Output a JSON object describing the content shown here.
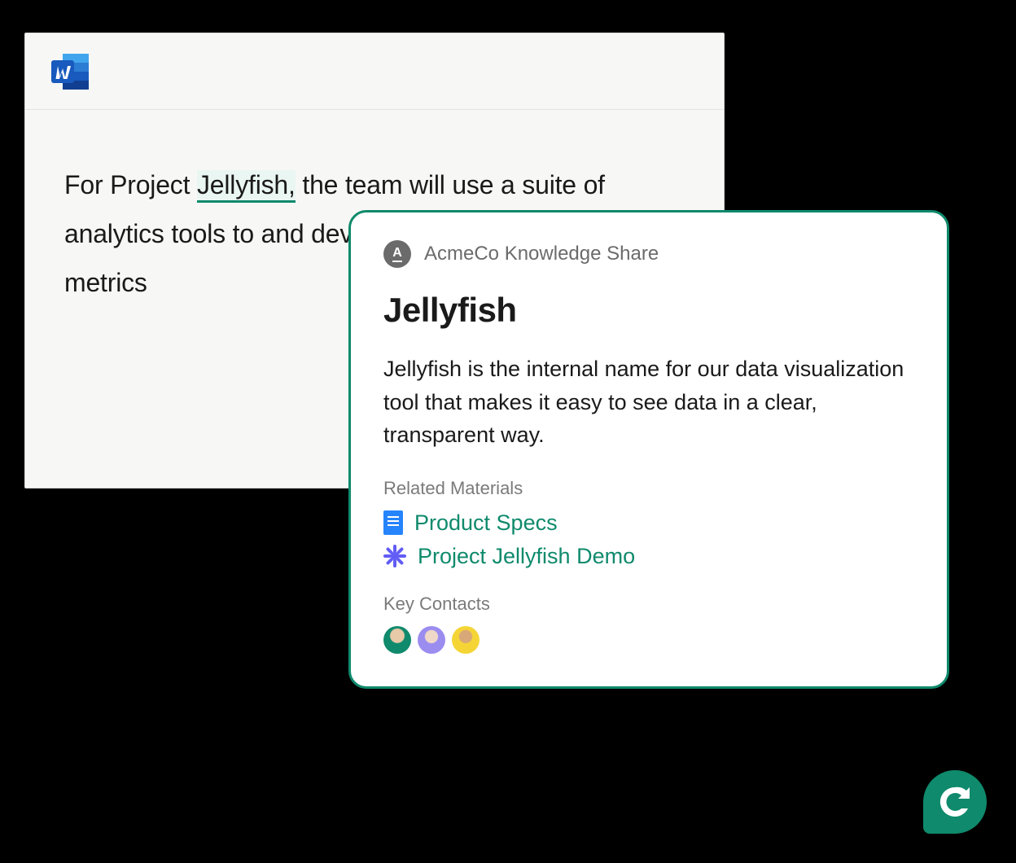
{
  "document": {
    "text_before_term": "For Project ",
    "term": "Jellyfish,",
    "text_after_term": " the team will use a suite of analytics tools to and develop an opti monitor key metrics"
  },
  "knowledge_card": {
    "source": "AcmeCo Knowledge Share",
    "title": "Jellyfish",
    "description": "Jellyfish is the internal name for our data visualization tool that makes it easy to see data in a clear, transparent way.",
    "related_label": "Related Materials",
    "related_items": [
      {
        "label": "Product Specs",
        "icon": "google-doc"
      },
      {
        "label": "Project Jellyfish Demo",
        "icon": "loom"
      }
    ],
    "contacts_label": "Key Contacts"
  }
}
